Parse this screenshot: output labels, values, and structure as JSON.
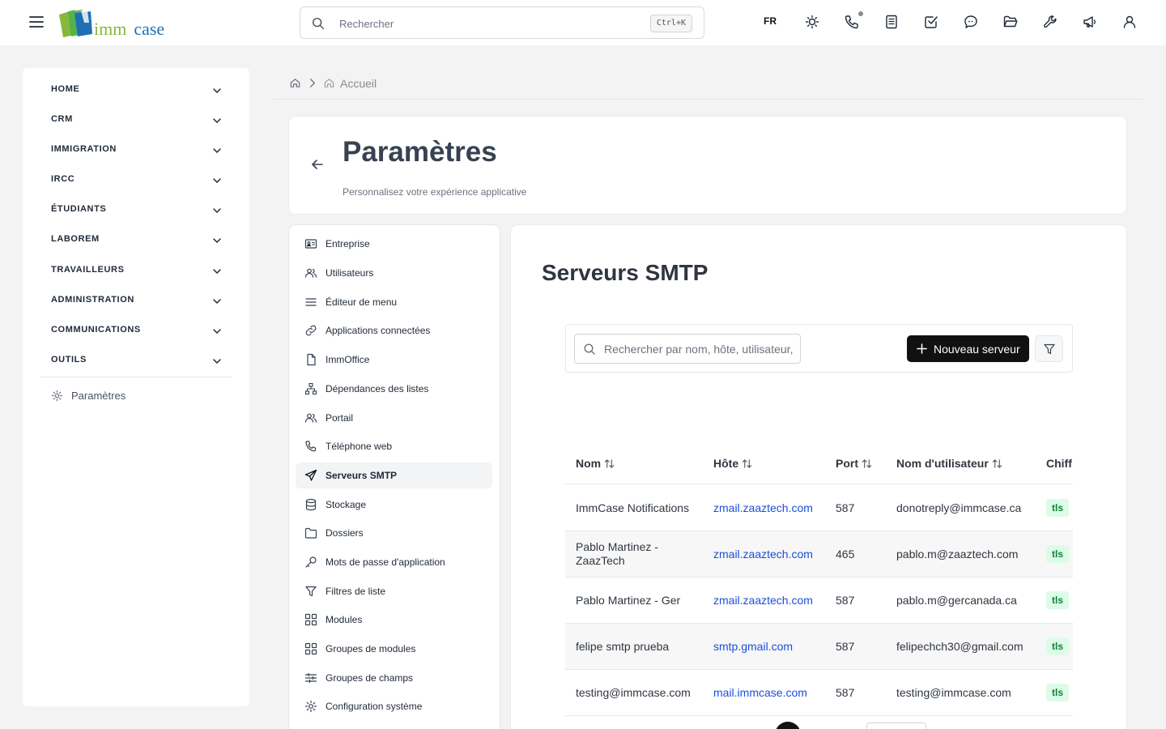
{
  "topbar": {
    "logo": {
      "imm": "imm",
      "case": "case"
    },
    "search_placeholder": "Rechercher",
    "search_shortcut": "Ctrl+K",
    "language": "FR",
    "icons": [
      "sun-icon",
      "phone-icon",
      "notes-icon",
      "checkbox-icon",
      "chat-icon",
      "folder-open-icon",
      "wrench-icon",
      "megaphone-icon",
      "user-icon"
    ]
  },
  "sidebar": {
    "items": [
      {
        "label": "HOME"
      },
      {
        "label": "CRM"
      },
      {
        "label": "IMMIGRATION"
      },
      {
        "label": "IRCC"
      },
      {
        "label": "ÉTUDIANTS"
      },
      {
        "label": "LABOREM"
      },
      {
        "label": "TRAVAILLEURS"
      },
      {
        "label": "ADMINISTRATION"
      },
      {
        "label": "COMMUNICATIONS"
      },
      {
        "label": "OUTILS"
      }
    ],
    "settings_label": "Paramètres"
  },
  "breadcrumb": {
    "current": "Accueil"
  },
  "header": {
    "title": "Paramètres",
    "subtitle": "Personnalisez votre expérience applicative"
  },
  "settings_menu": {
    "items": [
      {
        "label": "Entreprise",
        "icon": "id-card-icon"
      },
      {
        "label": "Utilisateurs",
        "icon": "users-icon"
      },
      {
        "label": "Éditeur de menu",
        "icon": "menu-lines-icon"
      },
      {
        "label": "Applications connectées",
        "icon": "link-icon"
      },
      {
        "label": "ImmOffice",
        "icon": "file-icon"
      },
      {
        "label": "Dépendances des listes",
        "icon": "hierarchy-icon"
      },
      {
        "label": "Portail",
        "icon": "users-icon"
      },
      {
        "label": "Téléphone web",
        "icon": "phone-icon"
      },
      {
        "label": "Serveurs SMTP",
        "icon": "send-icon",
        "active": true
      },
      {
        "label": "Stockage",
        "icon": "database-icon"
      },
      {
        "label": "Dossiers",
        "icon": "folder-icon"
      },
      {
        "label": "Mots de passe d'application",
        "icon": "key-icon"
      },
      {
        "label": "Filtres de liste",
        "icon": "filter-icon"
      },
      {
        "label": "Modules",
        "icon": "grid-icon"
      },
      {
        "label": "Groupes de modules",
        "icon": "grid-icon"
      },
      {
        "label": "Groupes de champs",
        "icon": "sliders-icon"
      },
      {
        "label": "Configuration système",
        "icon": "gear-icon"
      }
    ]
  },
  "smtp": {
    "title": "Serveurs SMTP",
    "search_placeholder": "Rechercher par nom, hôte, utilisateur, email...",
    "new_button": "Nouveau serveur",
    "columns": {
      "name": "Nom",
      "host": "Hôte",
      "port": "Port",
      "username": "Nom d'utilisateur",
      "encryption": "Chiff"
    },
    "rows": [
      {
        "name": "ImmCase Notifications",
        "host": "zmail.zaaztech.com",
        "port": "587",
        "username": "donotreply@immcase.ca",
        "encryption": "tls"
      },
      {
        "name": "Pablo Martinez - ZaazTech",
        "host": "zmail.zaaztech.com",
        "port": "465",
        "username": "pablo.m@zaaztech.com",
        "encryption": "tls"
      },
      {
        "name": "Pablo Martinez - Ger",
        "host": "zmail.zaaztech.com",
        "port": "587",
        "username": "pablo.m@gercanada.ca",
        "encryption": "tls"
      },
      {
        "name": "felipe smtp prueba",
        "host": "smtp.gmail.com",
        "port": "587",
        "username": "felipechch30@gmail.com",
        "encryption": "tls"
      },
      {
        "name": "testing@immcase.com",
        "host": "mail.immcase.com",
        "port": "587",
        "username": "testing@immcase.com",
        "encryption": "tls"
      }
    ]
  },
  "colors": {
    "accent": "#111111",
    "link": "#1d4ed8",
    "badge_bg": "#dcfce7",
    "badge_text": "#15803d",
    "logo_green": "#86b83a",
    "logo_blue": "#1f6fb5"
  }
}
